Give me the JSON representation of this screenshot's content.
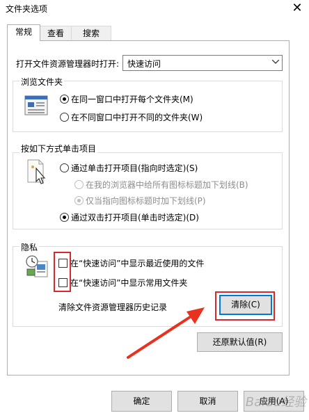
{
  "window": {
    "title": "文件夹选项"
  },
  "tabs": [
    {
      "label": "常规"
    },
    {
      "label": "查看"
    },
    {
      "label": "搜索"
    }
  ],
  "open_explorer": {
    "label": "打开文件资源管理器时打开:",
    "value": "快速访问"
  },
  "browse_folders": {
    "legend": "浏览文件夹",
    "options": [
      {
        "label": "在同一窗口中打开每个文件夹(M)",
        "checked": true
      },
      {
        "label": "在不同窗口中打开不同的文件夹(W)",
        "checked": false
      }
    ]
  },
  "click_items": {
    "legend": "按如下方式单击项目",
    "single_click": {
      "label": "通过单击打开项目(指向时选定)(S)",
      "checked": false
    },
    "sub_options": [
      {
        "label": "在我的浏览器中给所有图标标题加下划线(B)",
        "checked": false
      },
      {
        "label": "仅当指向图标标题时加下划线(P)",
        "checked": true
      }
    ],
    "double_click": {
      "label": "通过双击打开项目(单击时选定)(D)",
      "checked": true
    }
  },
  "privacy": {
    "legend": "隐私",
    "checkboxes": [
      {
        "label": "在“快速访问”中显示最近使用的文件",
        "checked": false
      },
      {
        "label": "在“快速访问”中显示常用文件夹",
        "checked": false
      }
    ],
    "clear_history_label": "清除文件资源管理器历史记录",
    "clear_button": "清除(C)"
  },
  "restore_defaults": "还原默认值(R)",
  "footer": {
    "ok": "确定",
    "cancel": "取消",
    "apply": "应用(A)"
  },
  "colors": {
    "highlight": "#d9272e",
    "accent": "#0078d7"
  },
  "watermark": "Baidu经验"
}
